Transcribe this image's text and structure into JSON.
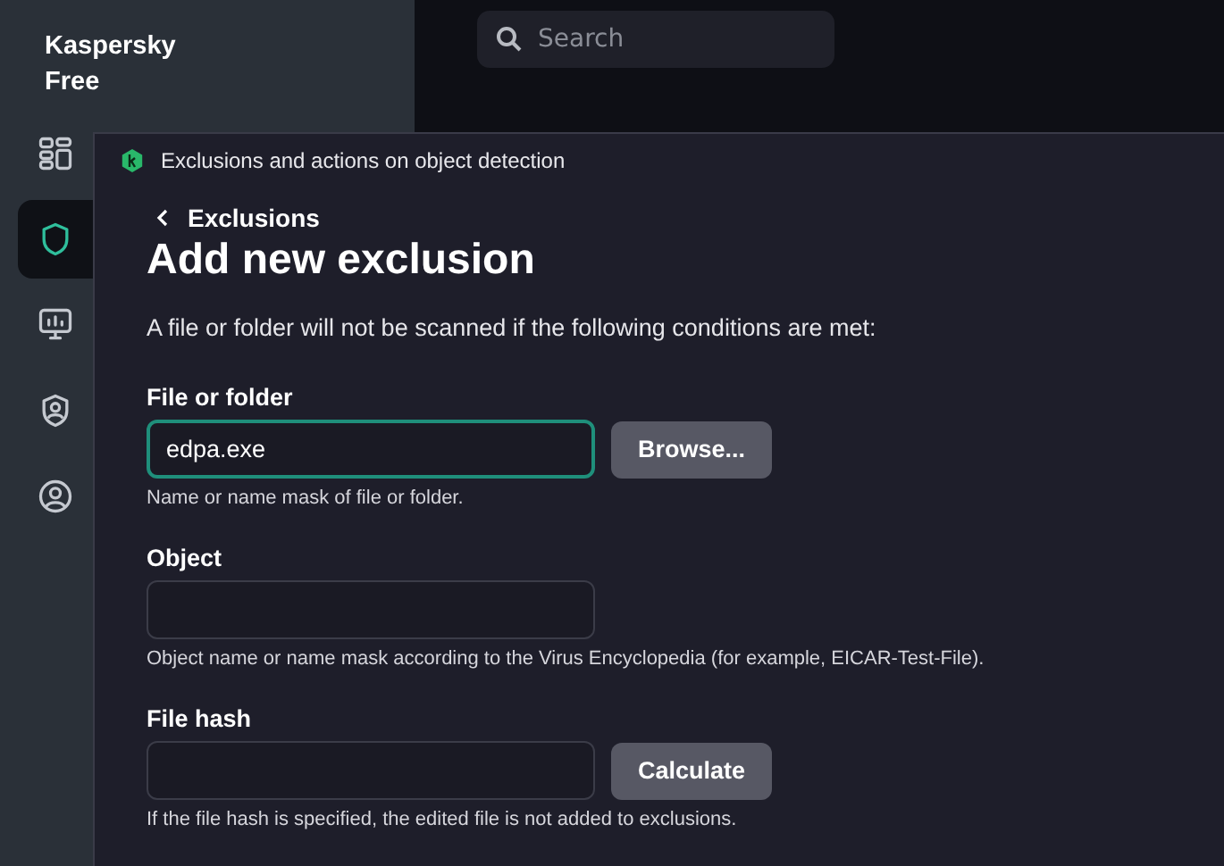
{
  "sidebar": {
    "title": "Kaspersky Free",
    "items": [
      {
        "kind": "dashboard",
        "selected": false
      },
      {
        "kind": "shield",
        "selected": true
      },
      {
        "kind": "monitor",
        "selected": false
      },
      {
        "kind": "privacy",
        "selected": false
      },
      {
        "kind": "account",
        "selected": false
      }
    ]
  },
  "search": {
    "placeholder": "Search"
  },
  "dialog": {
    "title": "Exclusions and actions on object detection",
    "back": "Exclusions",
    "heading": "Add new exclusion",
    "description": "A file or folder will not be scanned if the following conditions are met:",
    "fields": [
      {
        "label": "File or folder",
        "value": "edpa.exe",
        "focused": true,
        "button": "Browse...",
        "hint": "Name or name mask of file or folder."
      },
      {
        "label": "Object",
        "focused": false,
        "hint": "Object name or name mask according to the Virus Encyclopedia (for example, EICAR-Test-File)."
      },
      {
        "label": "File hash",
        "focused": false,
        "button": "Calculate",
        "hint": "If the file hash is specified, the edited file is not added to exclusions."
      }
    ]
  }
}
